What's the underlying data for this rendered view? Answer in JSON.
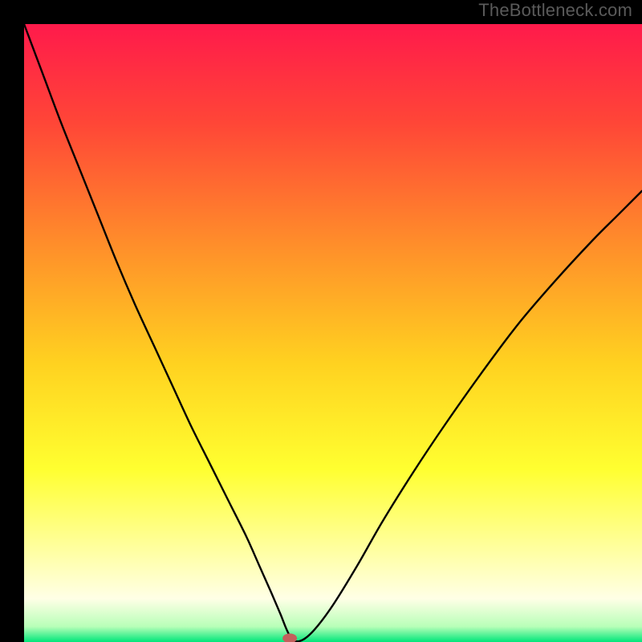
{
  "watermark": "TheBottleneck.com",
  "chart_data": {
    "type": "line",
    "title": "",
    "xlabel": "",
    "ylabel": "",
    "xlim": [
      0,
      100
    ],
    "ylim": [
      0,
      100
    ],
    "background_gradient": {
      "stops": [
        {
          "offset": 0.0,
          "color": "#ff1a4b"
        },
        {
          "offset": 0.16,
          "color": "#ff4637"
        },
        {
          "offset": 0.36,
          "color": "#ff8f2a"
        },
        {
          "offset": 0.55,
          "color": "#ffd220"
        },
        {
          "offset": 0.72,
          "color": "#ffff30"
        },
        {
          "offset": 0.85,
          "color": "#ffffa0"
        },
        {
          "offset": 0.93,
          "color": "#ffffe6"
        },
        {
          "offset": 0.975,
          "color": "#b8ffb8"
        },
        {
          "offset": 1.0,
          "color": "#00e67a"
        }
      ]
    },
    "series": [
      {
        "name": "bottleneck-curve",
        "x": [
          0.0,
          3.0,
          6.0,
          9.0,
          12.0,
          15.0,
          18.0,
          21.0,
          24.0,
          27.0,
          30.0,
          33.0,
          36.0,
          38.0,
          40.0,
          41.5,
          42.5,
          43.5,
          45.0,
          47.0,
          50.0,
          54.0,
          58.0,
          63.0,
          68.0,
          74.0,
          80.0,
          86.0,
          92.0,
          96.0,
          100.0
        ],
        "y": [
          100.0,
          92.0,
          84.0,
          76.5,
          69.0,
          61.5,
          54.5,
          48.0,
          41.5,
          35.0,
          29.0,
          23.0,
          17.0,
          12.5,
          8.0,
          4.5,
          2.0,
          0.3,
          0.3,
          2.0,
          6.0,
          12.5,
          19.5,
          27.5,
          35.0,
          43.5,
          51.5,
          58.5,
          65.0,
          69.0,
          73.0
        ]
      }
    ],
    "marker": {
      "name": "optimal-point",
      "x": 43.0,
      "y": 0.6,
      "color": "#c3605c",
      "rx": 9,
      "ry": 6
    }
  }
}
